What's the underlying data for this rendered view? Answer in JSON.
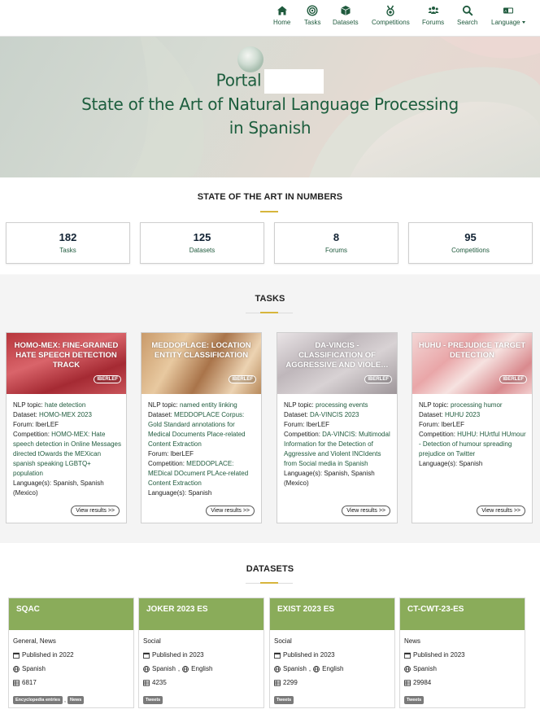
{
  "nav": {
    "items": [
      {
        "label": "Home",
        "icon": "home-icon"
      },
      {
        "label": "Tasks",
        "icon": "target-icon"
      },
      {
        "label": "Datasets",
        "icon": "cube-icon"
      },
      {
        "label": "Competitions",
        "icon": "medal-icon"
      },
      {
        "label": "Forums",
        "icon": "users-icon"
      },
      {
        "label": "Search",
        "icon": "search-icon"
      },
      {
        "label": "Language",
        "icon": "language-icon"
      }
    ]
  },
  "hero": {
    "line1": "Portal",
    "line2": "State of the Art of Natural Language Processing",
    "line3": "in Spanish"
  },
  "numbers": {
    "title": "STATE OF THE ART IN NUMBERS",
    "items": [
      {
        "value": "182",
        "label": "Tasks"
      },
      {
        "value": "125",
        "label": "Datasets"
      },
      {
        "value": "8",
        "label": "Forums"
      },
      {
        "value": "95",
        "label": "Competitions"
      }
    ]
  },
  "tasks": {
    "title": "TASKS",
    "labels": {
      "topic": "NLP topic:",
      "dataset": "Dataset:",
      "forum": "Forum:",
      "competition": "Competition:",
      "languages": "Language(s):",
      "view": "View results >>"
    },
    "items": [
      {
        "title": "HOMO-MEX: FINE-GRAINED HATE SPEECH DETECTION TRACK",
        "badge": "IBERLEF",
        "topic": "hate detection",
        "dataset": "HOMO-MEX 2023",
        "forum": "IberLEF",
        "competition": "HOMO-MEX: Hate speech detection in Online Messages directed tOwards the MEXican spanish speaking LGBTQ+ population",
        "languages": "Spanish, Spanish (Mexico)"
      },
      {
        "title": "MEDDOPLACE: LOCATION ENTITY CLASSIFICATION",
        "badge": "IBERLEF",
        "topic": "named entity linking",
        "dataset": "MEDDOPLACE Corpus: Gold Standard annotations for Medical Documents Place-related Content Extraction",
        "forum": "IberLEF",
        "competition": "MEDDOPLACE: MEDical DOcument PLAce-related Content Extraction",
        "languages": "Spanish"
      },
      {
        "title": "DA-VINCIS - CLASSIFICATION OF AGGRESSIVE AND VIOLE…",
        "badge": "IBERLEF",
        "topic": "processing events",
        "dataset": "DA-VINCIS 2023",
        "forum": "IberLEF",
        "competition": "DA-VINCIS: Multimodal Information for the Detection of Aggressive and Violent INCIdents from Social media in Spanish",
        "languages": "Spanish, Spanish (Mexico)"
      },
      {
        "title": "HUHU - PREJUDICE TARGET DETECTION",
        "badge": "IBERLEF",
        "topic": "processing humor",
        "dataset": "HUHU 2023",
        "forum": "IberLEF",
        "competition": "HUHU: HUrtful HUmour - Detection of humour spreading prejudice on Twitter",
        "languages": "Spanish"
      }
    ]
  },
  "datasets": {
    "title": "DATASETS",
    "items": [
      {
        "name": "SQAC",
        "domain": "General, News",
        "published": "Published in 2022",
        "langs": [
          "Spanish"
        ],
        "size": "6817",
        "tags": [
          "Encyclopedia entries",
          "News"
        ]
      },
      {
        "name": "JOKER 2023 ES",
        "domain": "Social",
        "published": "Published in 2023",
        "langs": [
          "Spanish",
          "English"
        ],
        "size": "4235",
        "tags": [
          "Tweets"
        ]
      },
      {
        "name": "EXIST 2023 ES",
        "domain": "Social",
        "published": "Published in 2023",
        "langs": [
          "Spanish",
          "English"
        ],
        "size": "2299",
        "tags": [
          "Tweets"
        ]
      },
      {
        "name": "CT-CWT-23-ES",
        "domain": "News",
        "published": "Published in 2023",
        "langs": [
          "Spanish"
        ],
        "size": "29984",
        "tags": [
          "Tweets"
        ]
      }
    ]
  },
  "colors": {
    "brand_green": "#1f5a3d",
    "accent_gold": "#d7b53c",
    "dataset_header": "#8aac5a"
  }
}
